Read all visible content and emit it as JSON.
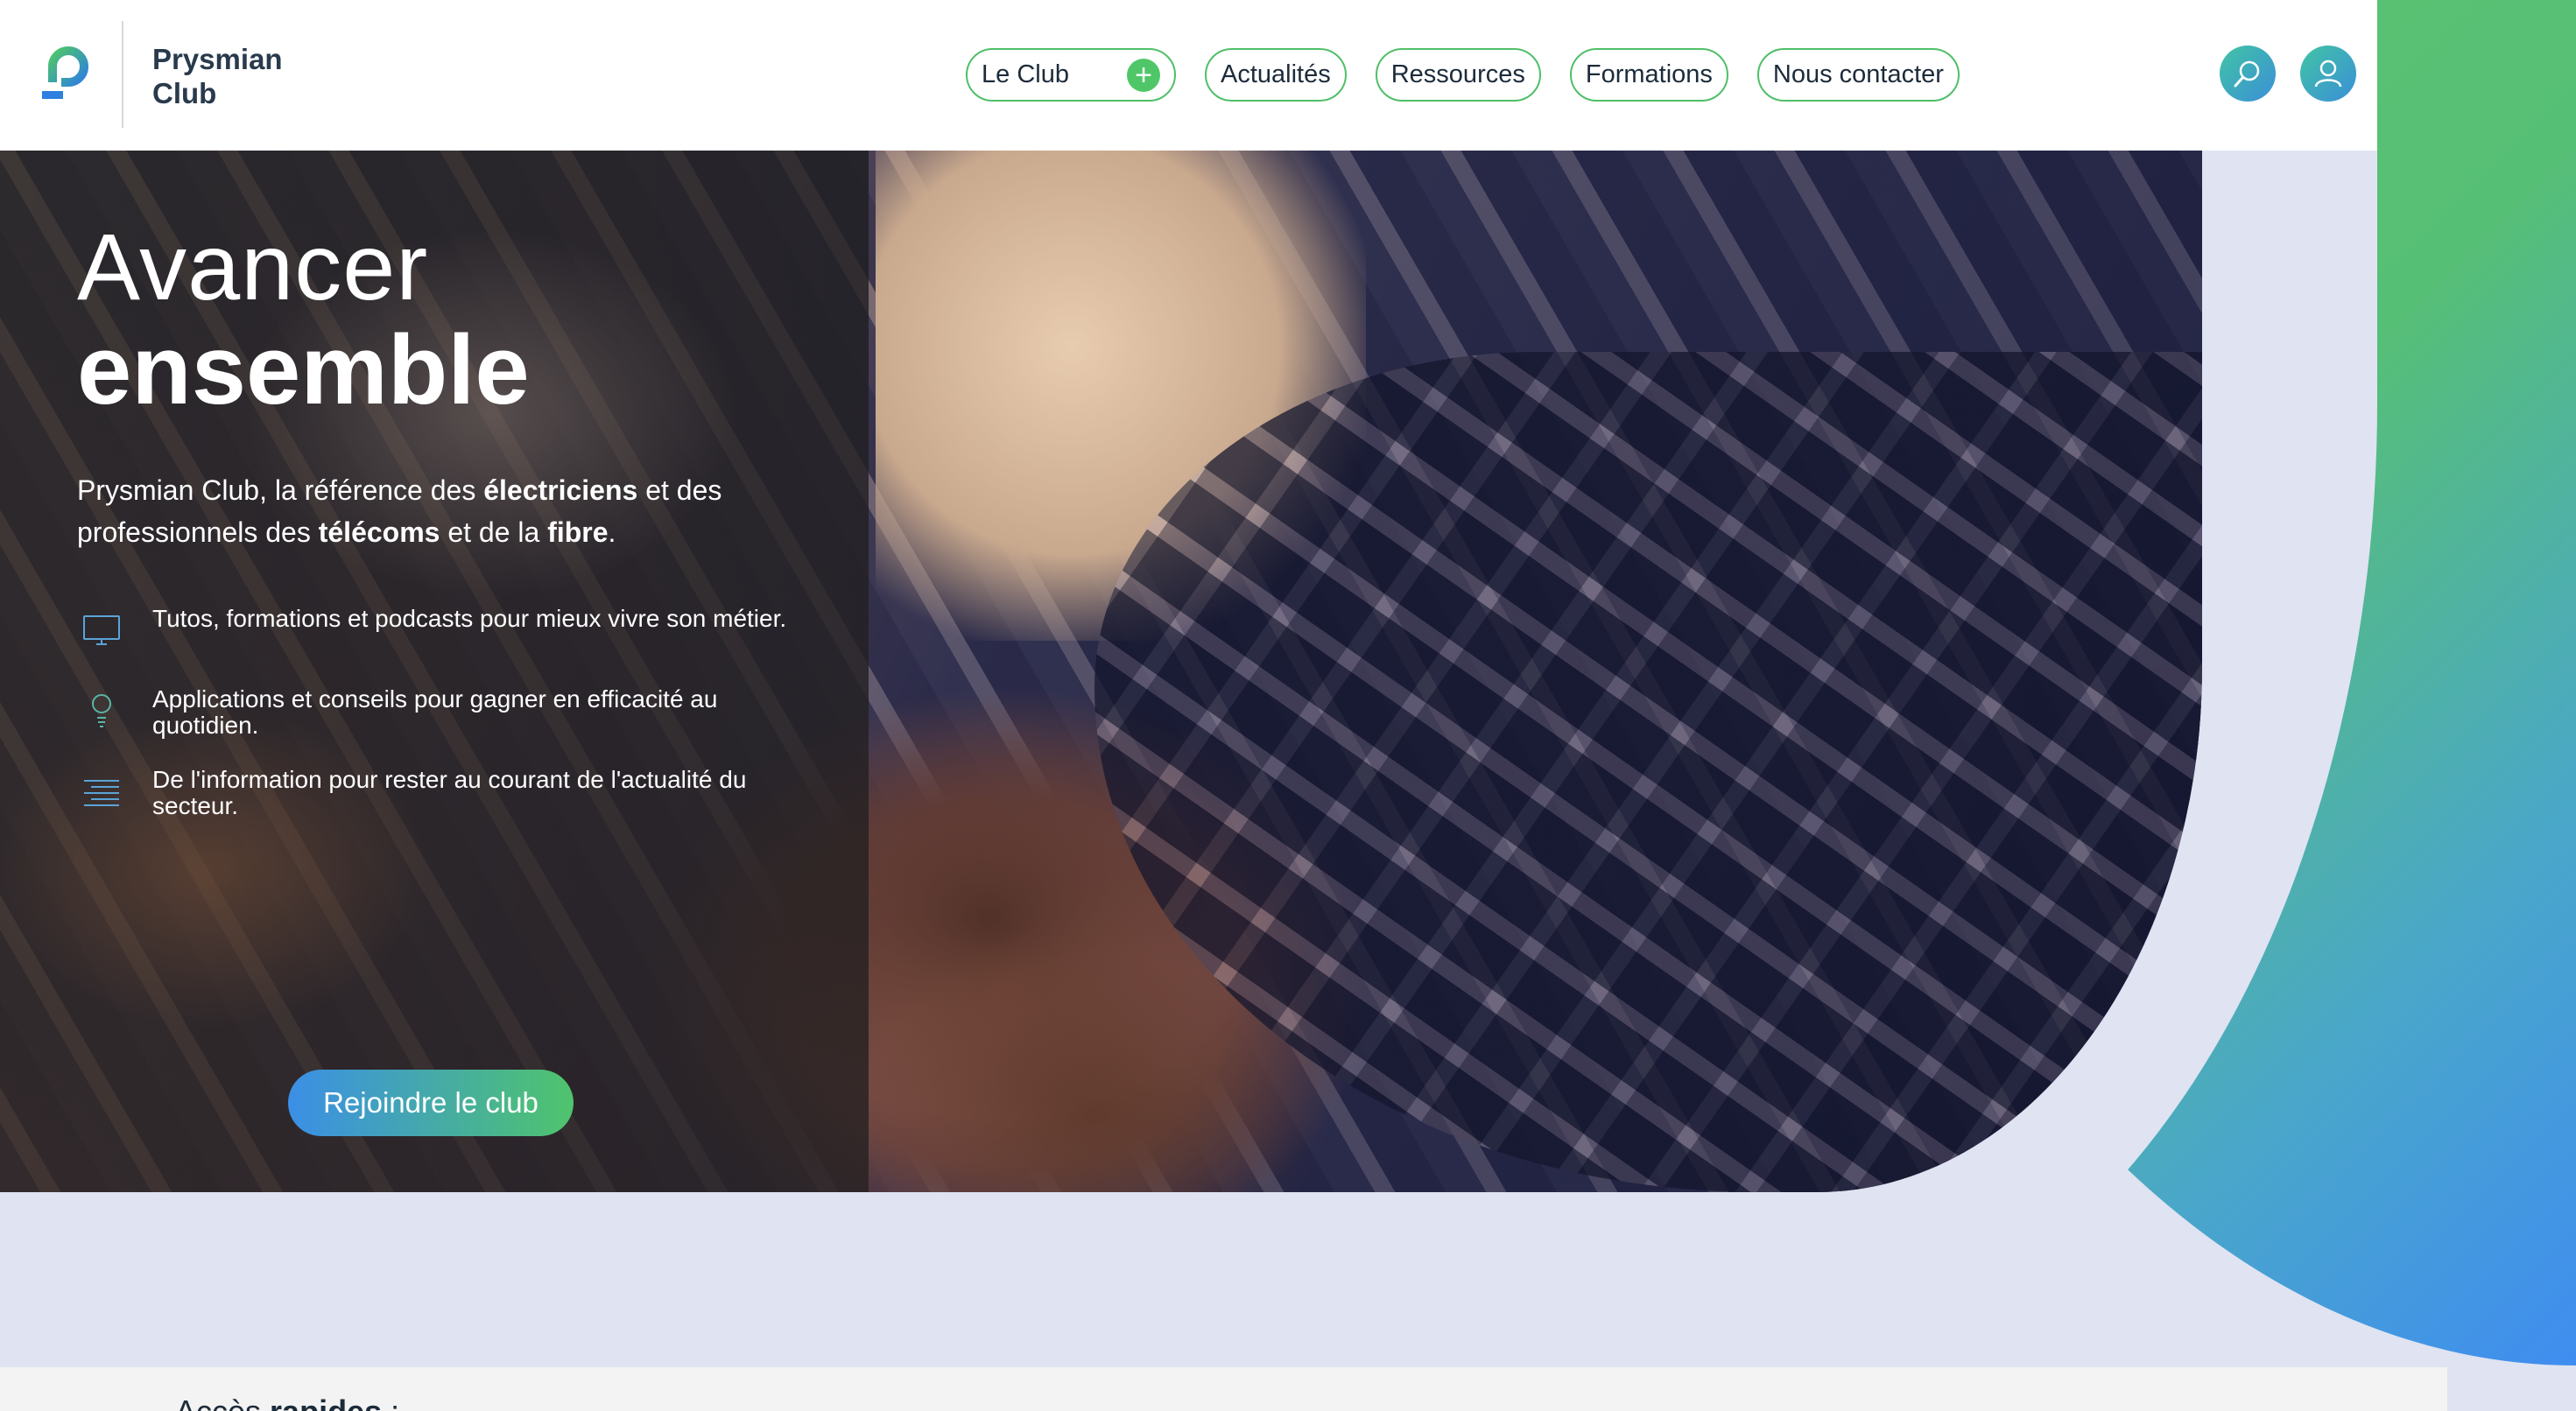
{
  "header": {
    "brand_line1": "Prysmian",
    "brand_line2": "Club",
    "nav": [
      {
        "label": "Le Club"
      },
      {
        "label": "Actualités"
      },
      {
        "label": "Ressources"
      },
      {
        "label": "Formations"
      },
      {
        "label": "Nous contacter"
      }
    ],
    "icons": {
      "search": "search-icon",
      "account": "user-icon",
      "expand": "plus-icon"
    }
  },
  "hero": {
    "title_light": "Avancer",
    "title_bold": "ensemble",
    "intro": {
      "p1": "Prysmian Club, la référence des ",
      "b1": "électriciens",
      "p2": " et des professionnels des ",
      "b2": "télécoms",
      "p3": " et de la ",
      "b3": "fibre",
      "p4": "."
    },
    "features": [
      {
        "icon": "monitor-icon",
        "text": "Tutos, formations et podcasts pour mieux vivre son métier."
      },
      {
        "icon": "lightbulb-icon",
        "text": "Applications et conseils pour gagner en efficacité au quotidien."
      },
      {
        "icon": "news-lines-icon",
        "text": "De l'information pour rester au courant de l'actualité du secteur."
      }
    ],
    "cta": "Rejoindre le club"
  },
  "quick_access": {
    "label_prefix": "Accès ",
    "label_bold": "rapides",
    "label_suffix": " :"
  },
  "colors": {
    "accent_green": "#4fbf68",
    "accent_blue": "#3b8fe6",
    "background": "#dfe3f2",
    "text_dark": "#1c2b3a"
  }
}
